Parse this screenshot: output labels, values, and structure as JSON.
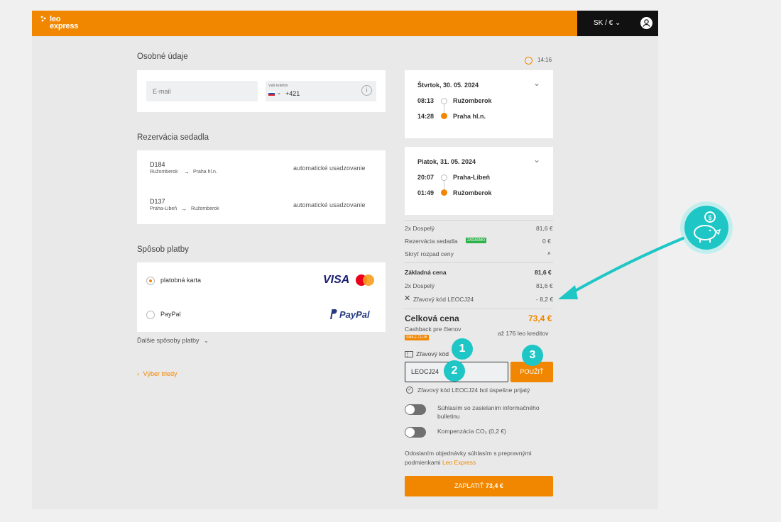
{
  "header": {
    "logo_line1": "leo",
    "logo_line2": "express",
    "lang_currency": "SK / € ⌄"
  },
  "personal": {
    "title": "Osobné údaje",
    "email_placeholder": "E-mail",
    "phone_label": "Váš telefón",
    "phone_prefix": "+421"
  },
  "timer": "14:16",
  "seats": {
    "title": "Rezervácia sedadla",
    "rows": [
      {
        "train": "D184",
        "from": "Ružomberok",
        "to": "Praha hl.n.",
        "mode": "automatické usadzovanie"
      },
      {
        "train": "D137",
        "from": "Praha-Libeň",
        "to": "Ružomberok",
        "mode": "automatické usadzovanie"
      }
    ]
  },
  "payment": {
    "title": "Spôsob platby",
    "options": [
      {
        "label": "platobná karta",
        "logo": "VISA"
      },
      {
        "label": "PayPal",
        "logo": "PayPal"
      }
    ],
    "more": "Ďalšie spôsoby platby",
    "back": "Výber triedy"
  },
  "trips": [
    {
      "date": "Štvrtok, 30. 05. 2024",
      "dep_time": "08:13",
      "dep_station": "Ružomberok",
      "arr_time": "14:28",
      "arr_station": "Praha hl.n."
    },
    {
      "date": "Piatok, 31. 05. 2024",
      "dep_time": "20:07",
      "dep_station": "Praha-Libeň",
      "arr_time": "01:49",
      "arr_station": "Ružomberok"
    }
  ],
  "summary": {
    "adults_label": "2x Dospelý",
    "adults_value": "81,6 €",
    "seat_label": "Rezervácia sedadla",
    "seat_badge": "ZADARMO",
    "seat_value": "0 €",
    "hide_label": "Skryť rozpad ceny",
    "base_label": "Základná cena",
    "base_value": "81,6 €",
    "adults2_label": "2x Dospelý",
    "adults2_value": "81,6 €",
    "discount_label": "Zľavový kód LEOCJ24",
    "discount_value": "- 8,2 €",
    "total_label": "Celková cena",
    "total_value": "73,4 €",
    "cashback_label": "Cashback pre členov",
    "cashback_badge": "SMILE CLUB",
    "cashback_value": "až 176 leo kreditov"
  },
  "promo": {
    "label": "Zľavový kód",
    "value": "LEOCJ24",
    "apply": "POUŽIŤ",
    "success": "Zľavový kód LEOCJ24 bol úspešne prijatý"
  },
  "consents": {
    "newsletter_line1": "Súhlasím so zasielaním informačného",
    "newsletter_line2": "bulletinu",
    "co2": "Kompenzácia CO₂ (0,2 €)"
  },
  "terms": {
    "line1": "Odoslaním objednávky súhlasím s prepravnými",
    "line2_prefix": "podmienkami",
    "link": "Leo Express"
  },
  "pay_button": {
    "label": "ZAPLATIŤ",
    "amount": "73,4 €"
  },
  "annotations": [
    "1",
    "2",
    "3"
  ],
  "colors": {
    "brand": "#f18700",
    "accent": "#1ec6c6",
    "frame": "#e9e9e9"
  }
}
